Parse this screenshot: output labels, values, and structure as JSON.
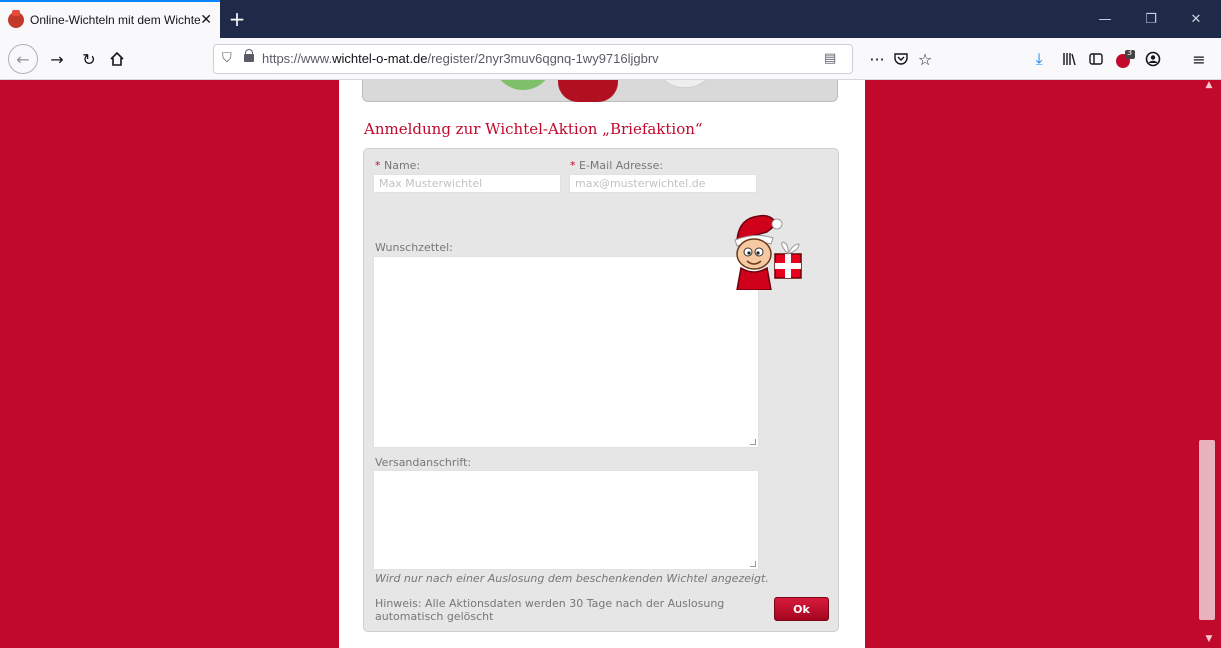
{
  "browser": {
    "tab_title": "Online-Wichteln mit dem Wichtel",
    "tab_close": "✕",
    "new_tab": "+",
    "url_prefix": "https://www.",
    "url_domain": "wichtel-o-mat.de",
    "url_path": "/register/2nyr3muv6qgnq-1wy9716ljgbrv",
    "menu_dots": "···",
    "minimize": "—",
    "restore": "❐",
    "close_window": "✕",
    "extension_badge": "3"
  },
  "page": {
    "heading": "Anmeldung zur Wichtel-Aktion „Briefaktion“",
    "name_label": "Name:",
    "name_required": "* ",
    "name_placeholder": "Max Musterwichtel",
    "email_label": "E-Mail Adresse:",
    "email_required": "* ",
    "email_placeholder": "max@musterwichtel.de",
    "wishlist_label": "Wunschzettel:",
    "address_label": "Versandanschrift:",
    "address_note": "Wird nur nach einer Auslosung dem beschenkenden Wichtel angezeigt.",
    "hint": "Hinweis: Alle Aktionsdaten werden 30 Tage nach der Auslosung automatisch gelöscht",
    "ok_button": "Ok"
  },
  "colors": {
    "background": "#c0092b",
    "accent": "#c0092b",
    "tabbar": "#1f2a48"
  }
}
